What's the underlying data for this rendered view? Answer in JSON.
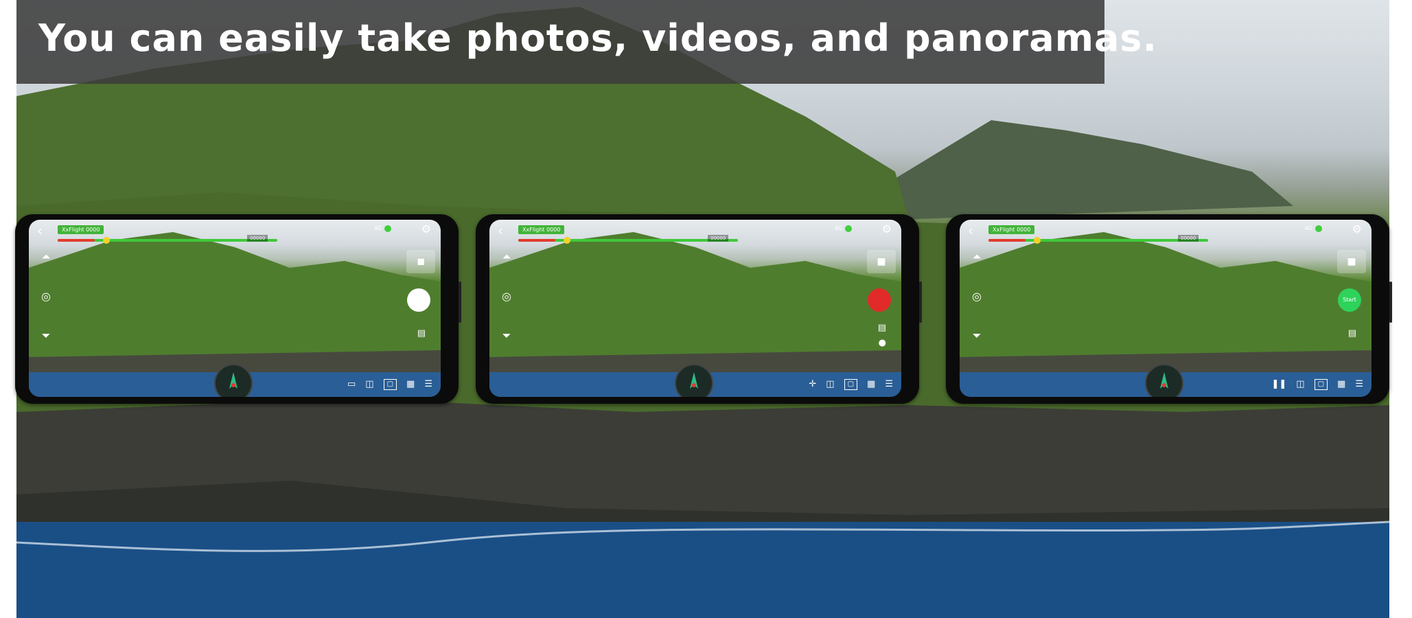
{
  "banner": {
    "text": "You can easily take photos, videos, and panoramas."
  },
  "phones": [
    {
      "mode": "photo",
      "badge": "XxFlight 0000",
      "altitude": "00000",
      "signal": "4G",
      "shutter_color": "#ffffff",
      "shutter_label": "",
      "left_icons": [
        "takeoff-icon",
        "camera-settings-icon",
        "landing-icon"
      ],
      "bottom_icons": [
        "file-icon",
        "vr-icon",
        "photo-mode-icon",
        "gallery-icon",
        "settings-icon"
      ]
    },
    {
      "mode": "video",
      "badge": "XxFlight 0000",
      "altitude": "00000",
      "signal": "4G",
      "shutter_color": "#e22a2a",
      "shutter_label": "",
      "left_icons": [
        "takeoff-icon",
        "camera-settings-icon",
        "landing-icon"
      ],
      "bottom_icons": [
        "joystick-icon",
        "vr-icon",
        "photo-mode-icon",
        "gallery-icon",
        "settings-icon"
      ]
    },
    {
      "mode": "panorama",
      "badge": "XxFlight 0000",
      "altitude": "00000",
      "signal": "4G",
      "shutter_color": "#2ed35b",
      "shutter_label": "Start",
      "left_icons": [
        "takeoff-icon",
        "camera-settings-icon",
        "landing-icon"
      ],
      "bottom_icons": [
        "pause-icon",
        "vr-icon",
        "photo-mode-icon",
        "gallery-icon",
        "settings-icon"
      ]
    }
  ]
}
